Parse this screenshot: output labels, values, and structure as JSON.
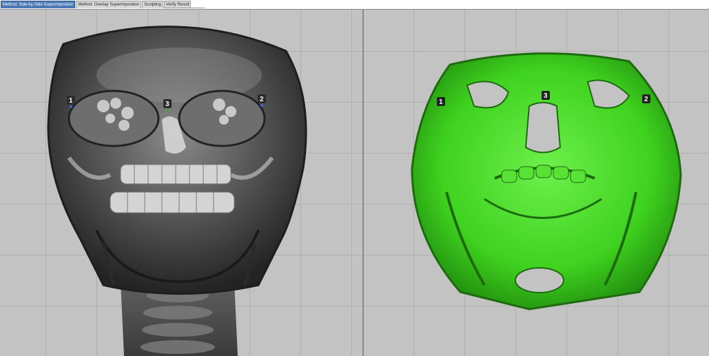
{
  "tabs": [
    {
      "label": "Method: Side-by-Side Superimposition",
      "active": true
    },
    {
      "label": "Method: Overlay Superimposition",
      "active": false
    },
    {
      "label": "Sculpting",
      "active": false
    },
    {
      "label": "Verify Result",
      "active": false
    }
  ],
  "left_viewport": {
    "render": "volume-rendered skull (grayscale, semi-transparent)",
    "markers": [
      {
        "label": "1",
        "color": "#3a6bd6"
      },
      {
        "label": "2",
        "color": "#3a6bd6"
      },
      {
        "label": "3",
        "color": "#2fae3a"
      }
    ]
  },
  "right_viewport": {
    "render": "surface-rendered skull (green)",
    "surface_color": "#3fd21f",
    "markers": [
      {
        "label": "1",
        "color": "#222222"
      },
      {
        "label": "2",
        "color": "#222222"
      },
      {
        "label": "3",
        "color": "#222222"
      }
    ]
  },
  "colors": {
    "viewport_bg": "#c3c3c3",
    "grid": "#aeaeae",
    "tab_active": "#4a78b5"
  }
}
